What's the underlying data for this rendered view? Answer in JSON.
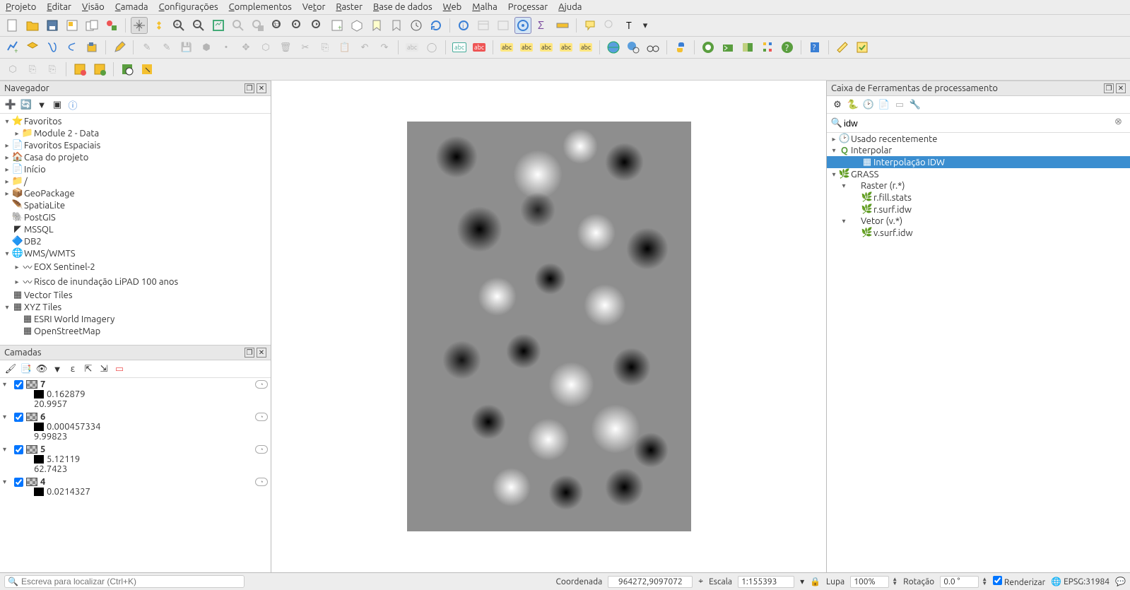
{
  "menu": [
    "Projeto",
    "Editar",
    "Visão",
    "Camada",
    "Configurações",
    "Complementos",
    "Vetor",
    "Raster",
    "Base de dados",
    "Web",
    "Malha",
    "Processar",
    "Ajuda"
  ],
  "browser": {
    "title": "Navegador",
    "items": [
      {
        "expander": "▾",
        "icon": "⭐",
        "label": "Favoritos",
        "indent": 0
      },
      {
        "expander": "▸",
        "icon": "📁",
        "label": "Module 2 - Data",
        "indent": 1
      },
      {
        "expander": "▸",
        "icon": "📄",
        "label": "Favoritos Espaciais",
        "indent": 0
      },
      {
        "expander": "▸",
        "icon": "🏠",
        "label": "Casa do projeto",
        "indent": 0
      },
      {
        "expander": "▸",
        "icon": "📄",
        "label": "Início",
        "indent": 0
      },
      {
        "expander": "▸",
        "icon": "📁",
        "label": "/",
        "indent": 0
      },
      {
        "expander": "▸",
        "icon": "📦",
        "label": "GeoPackage",
        "indent": 0
      },
      {
        "expander": "",
        "icon": "🪶",
        "label": "SpatiaLite",
        "indent": 0
      },
      {
        "expander": "",
        "icon": "🐘",
        "label": "PostGIS",
        "indent": 0
      },
      {
        "expander": "",
        "icon": "◤",
        "label": "MSSQL",
        "indent": 0
      },
      {
        "expander": "",
        "icon": "🔷",
        "label": "DB2",
        "indent": 0
      },
      {
        "expander": "▾",
        "icon": "🌐",
        "label": "WMS/WMTS",
        "indent": 0
      },
      {
        "expander": "▸",
        "icon": "〰",
        "label": "EOX Sentinel-2",
        "indent": 1
      },
      {
        "expander": "▸",
        "icon": "〰",
        "label": "Risco de inundação LiPAD 100 anos",
        "indent": 1
      },
      {
        "expander": "",
        "icon": "▦",
        "label": "Vector Tiles",
        "indent": 0
      },
      {
        "expander": "▾",
        "icon": "▦",
        "label": "XYZ Tiles",
        "indent": 0
      },
      {
        "expander": "",
        "icon": "▦",
        "label": "ESRI World Imagery",
        "indent": 1
      },
      {
        "expander": "",
        "icon": "▦",
        "label": "OpenStreetMap",
        "indent": 1
      }
    ]
  },
  "layers": {
    "title": "Camadas",
    "items": [
      {
        "name": "7",
        "min": "0.162879",
        "max": "20.9957"
      },
      {
        "name": "6",
        "min": "0.000457334",
        "max": "9.99823"
      },
      {
        "name": "5",
        "min": "5.12119",
        "max": "62.7423"
      },
      {
        "name": "4",
        "min": "0.0214327",
        "max": ""
      }
    ]
  },
  "processing": {
    "title": "Caixa de Ferramentas de processamento",
    "search": "idw",
    "tree": [
      {
        "expander": "▸",
        "icon": "🕑",
        "label": "Usado recentemente",
        "indent": 0,
        "sel": false
      },
      {
        "expander": "▾",
        "icon": "Q",
        "label": "Interpolar",
        "indent": 0,
        "sel": false,
        "iconColor": "#5a9e3f"
      },
      {
        "expander": "",
        "icon": "▦",
        "label": "Interpolação IDW",
        "indent": 2,
        "sel": true
      },
      {
        "expander": "▾",
        "icon": "🌿",
        "label": "GRASS",
        "indent": 0,
        "sel": false
      },
      {
        "expander": "▾",
        "icon": "",
        "label": "Raster (r.*)",
        "indent": 1,
        "sel": false
      },
      {
        "expander": "",
        "icon": "🌿",
        "label": "r.fill.stats",
        "indent": 2,
        "sel": false
      },
      {
        "expander": "",
        "icon": "🌿",
        "label": "r.surf.idw",
        "indent": 2,
        "sel": false
      },
      {
        "expander": "▾",
        "icon": "",
        "label": "Vetor (v.*)",
        "indent": 1,
        "sel": false
      },
      {
        "expander": "",
        "icon": "🌿",
        "label": "v.surf.idw",
        "indent": 2,
        "sel": false
      }
    ]
  },
  "statusbar": {
    "search_placeholder": "Escreva para localizar (Ctrl+K)",
    "coord_label": "Coordenada",
    "coord_value": "964272,9097072",
    "scale_label": "Escala",
    "scale_value": "1:155393",
    "lupa_label": "Lupa",
    "lupa_value": "100%",
    "rot_label": "Rotação",
    "rot_value": "0.0 °",
    "render_label": "Renderizar",
    "crs": "EPSG:31984"
  }
}
